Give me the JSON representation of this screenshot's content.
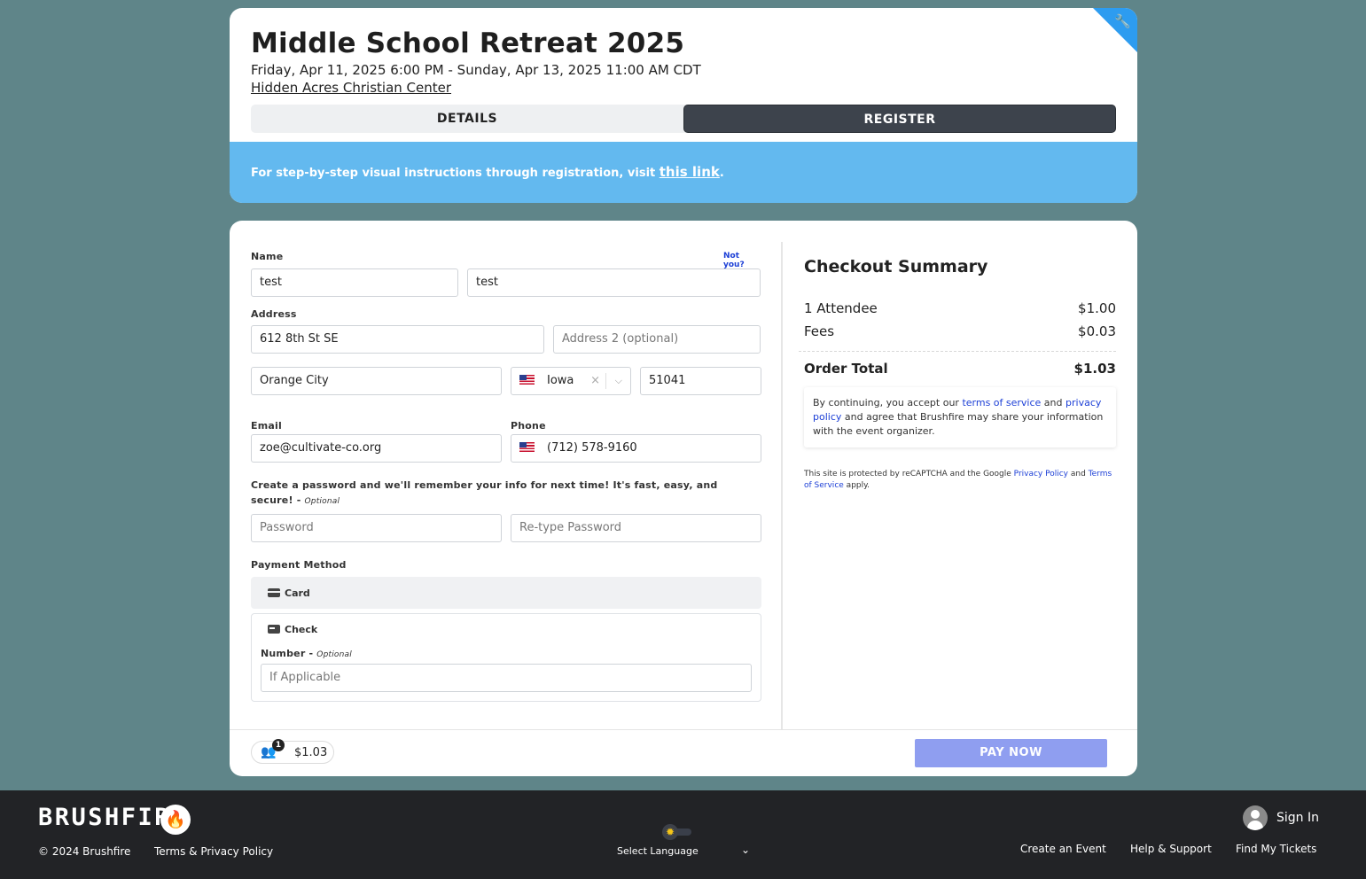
{
  "event": {
    "title": "Middle School Retreat 2025",
    "date": "Friday, Apr 11, 2025 6:00 PM - Sunday, Apr 13, 2025 11:00 AM CDT",
    "venue": "Hidden Acres Christian Center",
    "tabs": {
      "details": "DETAILS",
      "register": "REGISTER"
    },
    "banner_text": "For step-by-step visual instructions through registration, visit ",
    "banner_link": "this link",
    "banner_end": "."
  },
  "form": {
    "name_label": "Name",
    "not_you": "Not you?",
    "first_name": "test",
    "last_name": "test",
    "address_label": "Address",
    "address1": "612 8th St SE",
    "address2_placeholder": "Address 2 (optional)",
    "city": "Orange City",
    "state": "Iowa",
    "zip": "51041",
    "email_label": "Email",
    "email": "zoe@cultivate-co.org",
    "phone_label": "Phone",
    "phone": "(712) 578-9160",
    "password_prompt": "Create a password and we'll remember your info for next time! It's fast, easy, and secure!",
    "password_optional": "Optional",
    "password_placeholder": "Password",
    "retype_placeholder": "Re-type Password",
    "payment_label": "Payment Method",
    "card_label": "Card",
    "check_label": "Check",
    "number_label": "Number",
    "number_optional": "Optional",
    "number_placeholder": "If Applicable"
  },
  "summary": {
    "title": "Checkout Summary",
    "attendee_label": "1 Attendee",
    "attendee_amount": "$1.00",
    "fees_label": "Fees",
    "fees_amount": "$0.03",
    "total_label": "Order Total",
    "total_amount": "$1.03",
    "terms_1": "By continuing, you accept our ",
    "terms_link": "terms of service",
    "terms_2": " and ",
    "privacy_link": "privacy policy",
    "terms_3": " and agree that Brushfire may share your information with the event organizer.",
    "recaptcha_1": "This site is protected by reCAPTCHA and the Google ",
    "recaptcha_privacy": "Privacy Policy",
    "recaptcha_2": " and ",
    "recaptcha_terms": "Terms of Service",
    "recaptcha_3": " apply."
  },
  "bottom": {
    "cart_count": "1",
    "cart_total": "$1.03",
    "pay_now": "PAY NOW"
  },
  "footer": {
    "brand": "BRUSHFIRE",
    "copyright": "© 2024 Brushfire",
    "terms_privacy": "Terms & Privacy Policy",
    "select_language": "Select Language",
    "sign_in": "Sign In",
    "create_event": "Create an Event",
    "help": "Help & Support",
    "find_tickets": "Find My Tickets"
  },
  "colors": {
    "page_bg": "#5f8589",
    "banner": "#63b9ef",
    "register_tab": "#3d434c",
    "pay_now": "#8f9ef0",
    "link": "#1c3fd6",
    "footer": "#222326"
  }
}
